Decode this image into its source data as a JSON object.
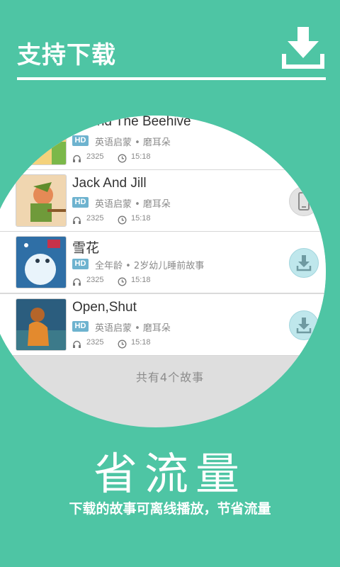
{
  "header": {
    "title": "支持下载",
    "icon": "download-icon"
  },
  "list": {
    "items": [
      {
        "title": "Round The Beehive",
        "tag": "HD",
        "meta": "英语启蒙 • 磨耳朵",
        "plays": "2325",
        "duration": "15:18",
        "action": "download"
      },
      {
        "title": "Jack And Jill",
        "tag": "HD",
        "meta": "英语启蒙 • 磨耳朵",
        "plays": "2325",
        "duration": "15:18",
        "action": "phone"
      },
      {
        "title": "雪花",
        "tag": "HD",
        "meta": "全年龄 • 2岁幼儿睡前故事",
        "plays": "2325",
        "duration": "15:18",
        "action": "download"
      },
      {
        "title": "Open,Shut",
        "tag": "HD",
        "meta": "英语启蒙 • 磨耳朵",
        "plays": "2325",
        "duration": "15:18",
        "action": "download"
      }
    ],
    "footer": "共有4个故事"
  },
  "slogan": {
    "big": "省流量",
    "sub": "下载的故事可离线播放，节省流量"
  },
  "colors": {
    "background": "#4ec5a4",
    "hd_badge": "#6eb3cf",
    "download_circle": "#bfe7ec"
  }
}
